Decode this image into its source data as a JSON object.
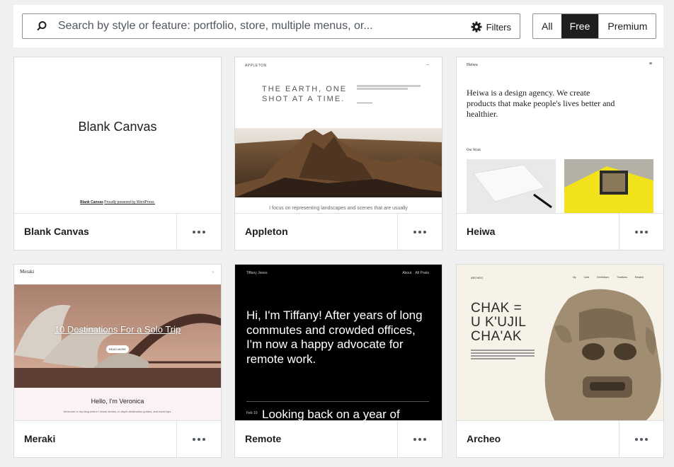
{
  "search": {
    "placeholder": "Search by style or feature: portfolio, store, multiple menus, or...",
    "filters_label": "Filters"
  },
  "tier_filter": {
    "options": [
      "All",
      "Free",
      "Premium"
    ],
    "selected": "Free"
  },
  "themes": [
    {
      "name": "Blank Canvas",
      "preview": {
        "title": "Blank Canvas",
        "footer_name": "Blank Canvas",
        "footer_text": "Proudly powered by WordPress."
      }
    },
    {
      "name": "Appleton",
      "preview": {
        "brand": "APPLETON",
        "headline_1": "THE EARTH, ONE",
        "headline_2": "SHOT AT A TIME.",
        "caption": "I focus on representing landscapes and scenes that are usually"
      }
    },
    {
      "name": "Heiwa",
      "preview": {
        "brand": "Heiwa",
        "intro": "Heiwa is a design agency. We create products that make people's lives better and healthier.",
        "section_label": "Our Work"
      }
    },
    {
      "name": "Meraki",
      "preview": {
        "brand": "Meraki",
        "hero_title": "10 Destinations For a Solo Trip",
        "hero_button": "READ MORE",
        "greeting": "Hello, I'm Veronica",
        "greeting_sub": "Welcome to my blog where I share stories, in-depth destination guides, and travel tips."
      }
    },
    {
      "name": "Remote",
      "preview": {
        "brand": "Tiffany Jones",
        "nav_about": "About",
        "nav_posts": "All Posts",
        "intro": "Hi, I'm Tiffany! After years of long commutes and crowded offices, I'm now a happy advocate for remote work.",
        "next_date": "Feb 10",
        "next_title": "Looking back on a year of"
      }
    },
    {
      "name": "Archeo",
      "preview": {
        "brand": "ARCHEO",
        "nav": "My Card  Exhibitions  Timelines  Related",
        "headline_1": "CHAK =",
        "headline_2": "U K'UJIL",
        "headline_3": "CHA'AK"
      }
    }
  ],
  "colors": {
    "page_bg": "#f0f0f1",
    "selected_segment": "#1e1e1e",
    "card_border": "#dcdcde"
  }
}
